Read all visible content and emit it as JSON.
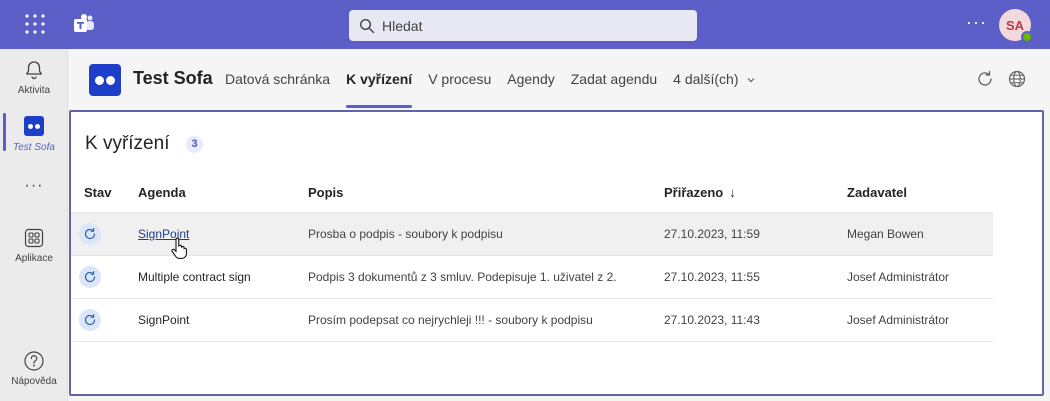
{
  "topbar": {
    "search_placeholder": "Hledat",
    "more_label": "···",
    "avatar_initials": "SA"
  },
  "rail": {
    "items": [
      {
        "label": "Aktivita",
        "icon": "bell-icon"
      },
      {
        "label": "Test Sofa",
        "icon": "test-sofa-app-icon",
        "active": true
      },
      {
        "label": "···",
        "icon": "more-apps-icon"
      },
      {
        "label": "Aplikace",
        "icon": "apps-grid-icon"
      },
      {
        "label": "Nápověda",
        "icon": "help-icon"
      }
    ]
  },
  "app": {
    "title": "Test Sofa",
    "tabs": [
      {
        "label": "Datová schránka"
      },
      {
        "label": "K vyřízení",
        "active": true
      },
      {
        "label": "V procesu"
      },
      {
        "label": "Agendy"
      },
      {
        "label": "Zadat agendu"
      },
      {
        "label": "4 další(ch)"
      }
    ]
  },
  "panel": {
    "title": "K vyřízení",
    "count": "3",
    "columns": {
      "stav": "Stav",
      "agenda": "Agenda",
      "popis": "Popis",
      "prirazeno": "Přiřazeno",
      "prirazeno_sort": "↓",
      "zadavatel": "Zadavatel"
    },
    "rows": [
      {
        "agenda": "SignPoint",
        "popis": "Prosba o podpis - soubory k podpisu",
        "prirazeno": "27.10.2023, 11:59",
        "zadavatel": "Megan Bowen"
      },
      {
        "agenda": "Multiple contract sign",
        "popis": "Podpis 3 dokumentů z 3 smluv. Podepisuje 1. uživatel z 2.",
        "prirazeno": "27.10.2023, 11:55",
        "zadavatel": "Josef Administrátor"
      },
      {
        "agenda": "SignPoint",
        "popis": "Prosím podepsat co nejrychleji !!! - soubory k podpisu",
        "prirazeno": "27.10.2023, 11:43",
        "zadavatel": "Josef Administrátor"
      }
    ]
  },
  "colors": {
    "brand": "#5b5fc7",
    "app_blue": "#1c3ec9",
    "presence": "#6bb700"
  }
}
